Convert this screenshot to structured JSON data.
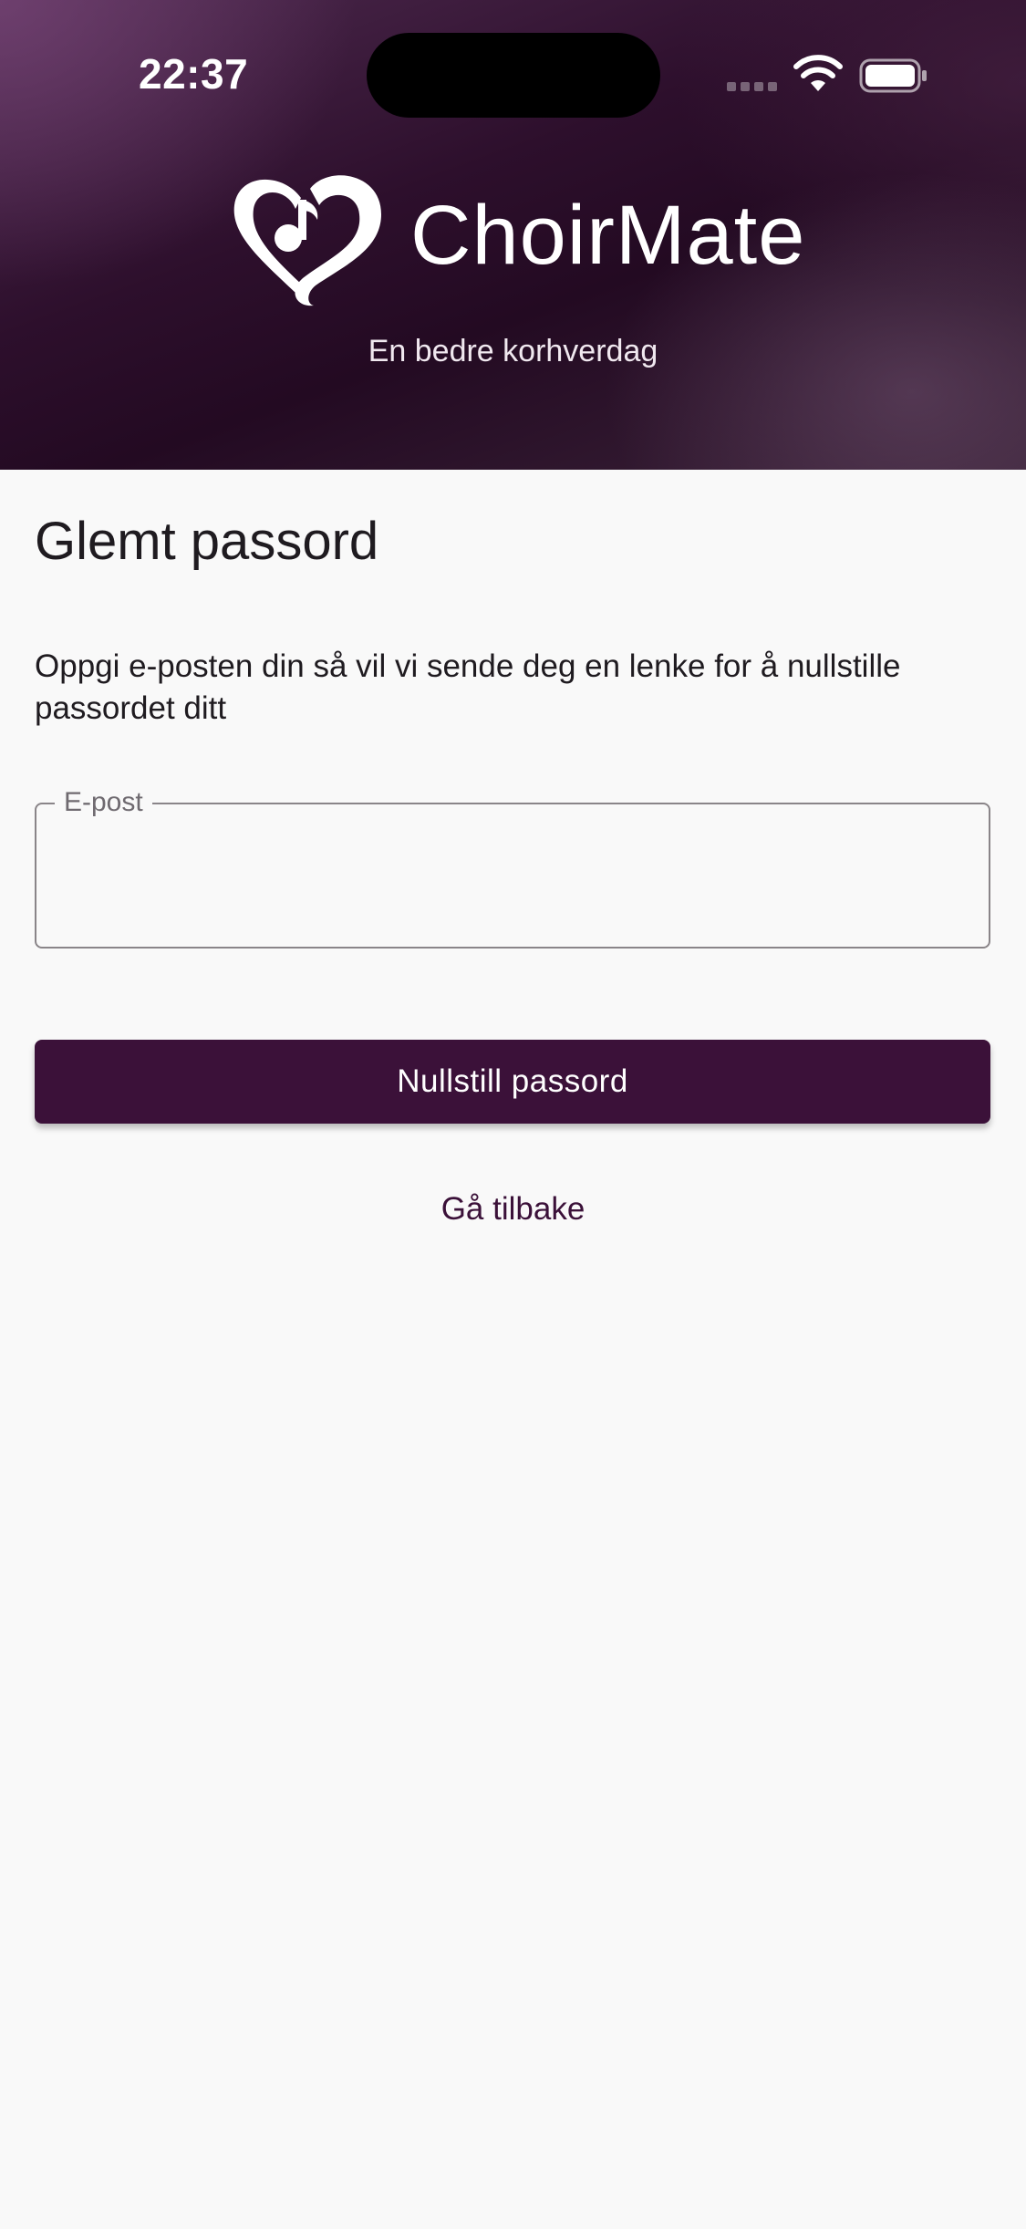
{
  "status_bar": {
    "time": "22:37"
  },
  "header": {
    "brand": "ChoirMate",
    "tagline": "En bedre korhverdag",
    "logo_icon": "heart-music-note-icon",
    "colors": {
      "header_dark": "#230a22",
      "accent": "#3b1139"
    }
  },
  "form": {
    "title": "Glemt passord",
    "description": "Oppgi e-posten din så vil vi sende deg en lenke for å nullstille passordet ditt",
    "email_label": "E-post",
    "email_value": "",
    "submit_label": "Nullstill passord",
    "back_label": "Gå tilbake"
  }
}
